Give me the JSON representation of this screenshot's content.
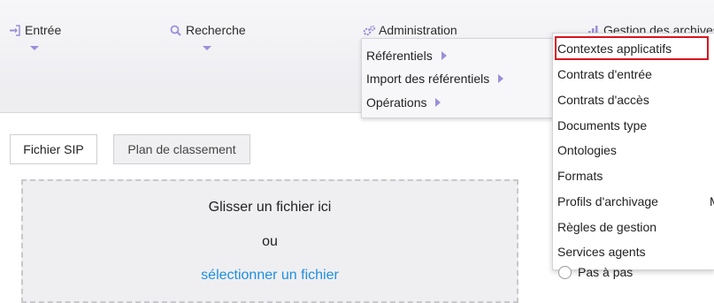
{
  "nav": {
    "entree": "Entrée",
    "recherche": "Recherche",
    "administration": "Administration",
    "gestion": "Gestion des archives"
  },
  "admin_menu": {
    "items": [
      {
        "label": "Référentiels"
      },
      {
        "label": "Import des référentiels"
      },
      {
        "label": "Opérations"
      }
    ]
  },
  "referentiels_submenu": {
    "items": [
      {
        "label": "Contextes applicatifs",
        "highlighted": true
      },
      {
        "label": "Contrats d'entrée"
      },
      {
        "label": "Contrats d'accès"
      },
      {
        "label": "Documents type"
      },
      {
        "label": "Ontologies"
      },
      {
        "label": "Formats"
      },
      {
        "label": "Profils d'archivage"
      },
      {
        "label": "Règles de gestion"
      },
      {
        "label": "Services agents"
      }
    ]
  },
  "tabs": {
    "sip": "Fichier SIP",
    "plan": "Plan de classement"
  },
  "dropzone": {
    "line1": "Glisser un fichier ici",
    "line2": "ou",
    "link": "sélectionner un fichier"
  },
  "right": {
    "radio_label": "Pas à pas",
    "partial_letter": "M"
  },
  "colors": {
    "accent": "#9b8fd8",
    "link": "#1f8fe0",
    "highlight": "#d9121f"
  }
}
